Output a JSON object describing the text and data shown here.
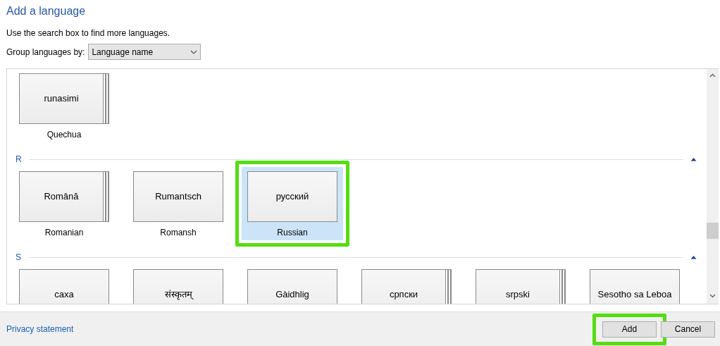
{
  "title": "Add a language",
  "hint": "Use the search box to find more languages.",
  "group_by": {
    "label": "Group languages by:",
    "value": "Language name"
  },
  "groups": [
    {
      "languages": [
        {
          "native": "runasimi",
          "name": "Quechua",
          "stacked": true,
          "selected": false,
          "highlighted": false
        }
      ]
    },
    {
      "letter": "R",
      "languages": [
        {
          "native": "Română",
          "name": "Romanian",
          "stacked": true,
          "selected": false,
          "highlighted": false
        },
        {
          "native": "Rumantsch",
          "name": "Romansh",
          "stacked": false,
          "selected": false,
          "highlighted": false
        },
        {
          "native": "русский",
          "name": "Russian",
          "stacked": false,
          "selected": true,
          "highlighted": true
        }
      ]
    },
    {
      "letter": "S",
      "languages": [
        {
          "native": "саха",
          "stacked": false,
          "selected": false,
          "highlighted": false
        },
        {
          "native": "संस्कृतम्",
          "stacked": false,
          "selected": false,
          "highlighted": false
        },
        {
          "native": "Gàidhlig",
          "stacked": false,
          "selected": false,
          "highlighted": false
        },
        {
          "native": "српски",
          "stacked": true,
          "selected": false,
          "highlighted": false
        },
        {
          "native": "srpski",
          "stacked": true,
          "selected": false,
          "highlighted": false
        },
        {
          "native": "Sesotho sa Leboa",
          "stacked": false,
          "selected": false,
          "highlighted": false
        }
      ]
    }
  ],
  "privacy_link": "Privacy statement",
  "buttons": [
    {
      "label": "Add",
      "highlighted": true
    },
    {
      "label": "Cancel",
      "highlighted": false
    }
  ]
}
